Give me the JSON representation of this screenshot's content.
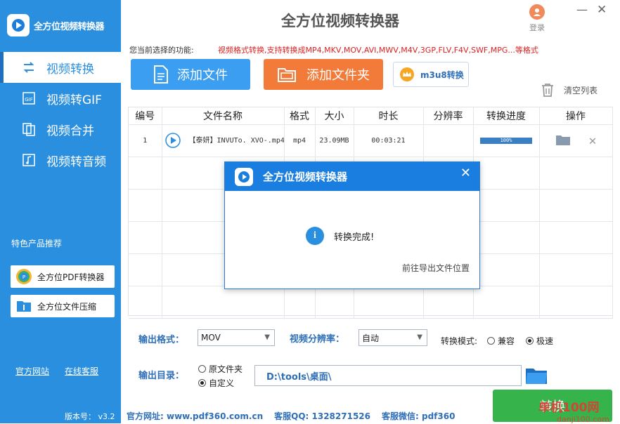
{
  "app": {
    "name": "全方位视频转换器",
    "login_label": "登录"
  },
  "sidebar": {
    "items": [
      {
        "label": "视频转换",
        "icon": "convert-icon"
      },
      {
        "label": "视频转GIF",
        "icon": "gif-icon"
      },
      {
        "label": "视频合并",
        "icon": "merge-icon"
      },
      {
        "label": "视频转音频",
        "icon": "music-icon"
      }
    ],
    "promo_title": "特色产品推荐",
    "promo": [
      {
        "label": "全方位PDF转换器",
        "icon": "pdf-app-icon"
      },
      {
        "label": "全方位文件压缩",
        "icon": "zip-app-icon"
      }
    ],
    "links": [
      "官方网站",
      "在线客服"
    ],
    "version": "版本号： v3.2"
  },
  "function": {
    "label": "您当前选择的功能:",
    "value": "视频格式转换,支持转换成MP4,MKV,MOV,AVI,MWV,M4V,3GP,FLV,F4V,SWF,MPG...等格式"
  },
  "toolbar": {
    "add_file": "添加文件",
    "add_folder": "添加文件夹",
    "m3u8": "m3u8转换",
    "clear": "清空列表"
  },
  "table": {
    "headers": [
      "编号",
      "文件名称",
      "格式",
      "大小",
      "时长",
      "分辨率",
      "转换进度",
      "操作"
    ],
    "rows": [
      {
        "index": "1",
        "name": "【泰妍】INVUTo. XVO-.mp4",
        "format": "mp4",
        "size": "23.09MB",
        "duration": "00:03:21",
        "resolution": "",
        "progress": "100%",
        "progress_value": 1.0
      }
    ]
  },
  "output": {
    "format_label": "输出格式：",
    "format_value": "MOV",
    "resolution_label": "视频分辨率：",
    "resolution_value": "自动",
    "mode_label": "转换模式:",
    "mode_options": [
      "兼容",
      "极速"
    ],
    "mode_selected": "极速",
    "dir_label": "输出目录：",
    "dir_options": [
      "原文件夹",
      "自定义"
    ],
    "dir_selected": "自定义",
    "path": "D:\\tools\\桌面\\"
  },
  "convert_button": "转换",
  "footer": {
    "site": "官方网址: www.pdf360.com.cn",
    "qq": "客服QQ: 1328271526",
    "wechat": "客服微信: pdf360"
  },
  "watermark": {
    "main": "单机100网",
    "sub": "danji100.com"
  },
  "dialog": {
    "title": "全方位视频转换器",
    "message": "转换完成!",
    "link": "前往导出文件位置"
  },
  "colors": {
    "primary": "#2b8fe0",
    "orange": "#f27b3a",
    "green": "#36b34a",
    "red": "#e02020"
  }
}
